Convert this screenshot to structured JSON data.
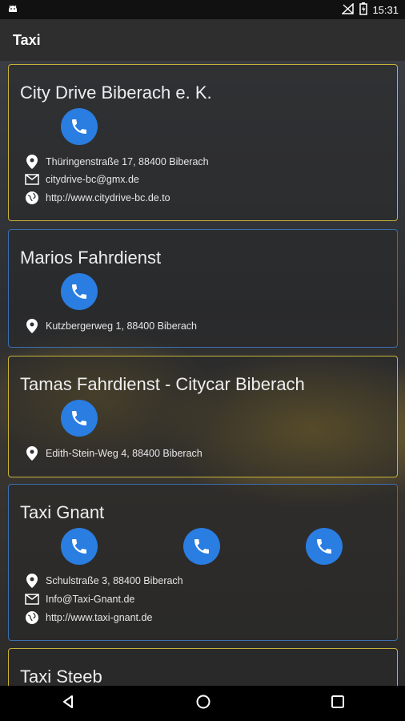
{
  "status": {
    "time": "15:31"
  },
  "appbar": {
    "title": "Taxi"
  },
  "cards": [
    {
      "title": "City Drive Biberach e. K.",
      "address": "Thüringenstraße 17, 88400 Biberach",
      "email": "citydrive-bc@gmx.de",
      "web": "http://www.citydrive-bc.de.to"
    },
    {
      "title": "Marios Fahrdienst",
      "address": "Kutzbergerweg 1, 88400 Biberach"
    },
    {
      "title": "Tamas Fahrdienst - Citycar Biberach",
      "address": "Edith-Stein-Weg 4, 88400 Biberach"
    },
    {
      "title": "Taxi Gnant",
      "address": "Schulstraße 3, 88400 Biberach",
      "email": "Info@Taxi-Gnant.de",
      "web": "http://www.taxi-gnant.de"
    },
    {
      "title": "Taxi Steeb"
    }
  ],
  "colors": {
    "accent": "#2a7de1",
    "card_border_yellow": "#c9b23a",
    "card_border_blue": "#3b6fb0"
  },
  "icons": [
    "android-icon",
    "signal-off-icon",
    "battery-icon",
    "phone-icon",
    "location-pin-icon",
    "mail-icon",
    "globe-icon",
    "back-icon",
    "home-icon",
    "recents-icon"
  ]
}
